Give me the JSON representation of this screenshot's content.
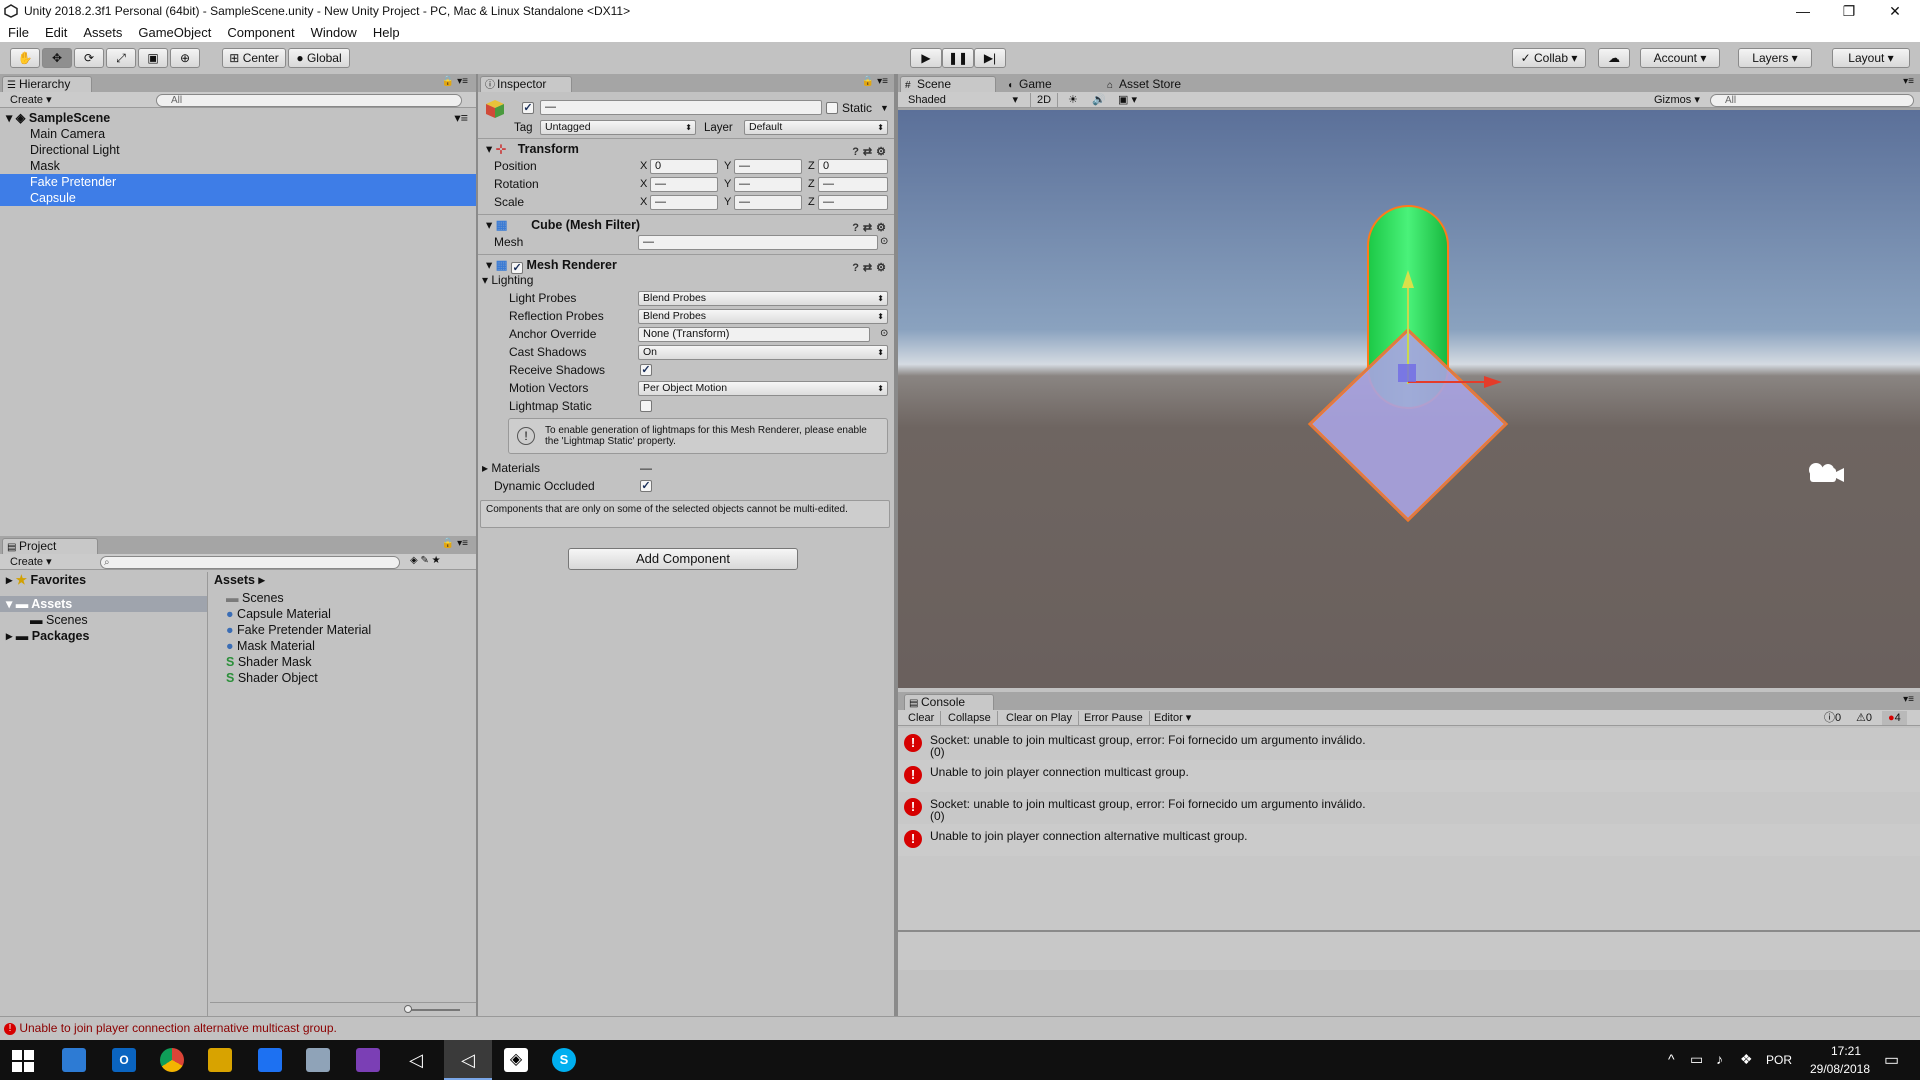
{
  "window": {
    "title": "Unity 2018.2.3f1 Personal (64bit) - SampleScene.unity - New Unity Project - PC, Mac & Linux Standalone <DX11>"
  },
  "menu": [
    "File",
    "Edit",
    "Assets",
    "GameObject",
    "Component",
    "Window",
    "Help"
  ],
  "toolbar": {
    "pivot": "Center",
    "space": "Global",
    "collab": "Collab",
    "account": "Account",
    "layers": "Layers",
    "layout": "Layout"
  },
  "hierarchy": {
    "tab": "Hierarchy",
    "create": "Create",
    "search_placeholder": "All",
    "scene": "SampleScene",
    "items": [
      {
        "label": "Main Camera",
        "selected": false
      },
      {
        "label": "Directional Light",
        "selected": false
      },
      {
        "label": "Mask",
        "selected": false
      },
      {
        "label": "Fake Pretender",
        "selected": true
      },
      {
        "label": "Capsule",
        "selected": true
      }
    ]
  },
  "project": {
    "tab": "Project",
    "create": "Create",
    "tree": {
      "favorites": "Favorites",
      "assets": "Assets",
      "scenes": "Scenes",
      "packages": "Packages"
    },
    "breadcrumb": "Assets",
    "files": [
      {
        "label": "Scenes",
        "icon": "folder-icon"
      },
      {
        "label": "Capsule Material",
        "icon": "material-icon"
      },
      {
        "label": "Fake Pretender Material",
        "icon": "material-icon"
      },
      {
        "label": "Mask Material",
        "icon": "material-icon"
      },
      {
        "label": "Shader Mask",
        "icon": "shader-icon"
      },
      {
        "label": "Shader Object",
        "icon": "shader-icon"
      }
    ]
  },
  "inspector": {
    "tab": "Inspector",
    "name_value": "—",
    "static_label": "Static",
    "tag_label": "Tag",
    "tag_value": "Untagged",
    "layer_label": "Layer",
    "layer_value": "Default",
    "transform": {
      "title": "Transform",
      "position": "Position",
      "rotation": "Rotation",
      "scale": "Scale",
      "axis_x": "X",
      "axis_y": "Y",
      "axis_z": "Z",
      "pos_x": "0",
      "pos_y": "—",
      "pos_z": "0",
      "mixed": "—"
    },
    "mesh_filter": {
      "title": "Cube (Mesh Filter)",
      "mesh_label": "Mesh",
      "mesh_value": "—"
    },
    "mesh_renderer": {
      "title": "Mesh Renderer",
      "lighting": "Lighting",
      "light_probes_label": "Light Probes",
      "light_probes_value": "Blend Probes",
      "reflection_probes_label": "Reflection Probes",
      "reflection_probes_value": "Blend Probes",
      "anchor_override_label": "Anchor Override",
      "anchor_override_value": "None (Transform)",
      "cast_shadows_label": "Cast Shadows",
      "cast_shadows_value": "On",
      "receive_shadows_label": "Receive Shadows",
      "motion_vectors_label": "Motion Vectors",
      "motion_vectors_value": "Per Object Motion",
      "lightmap_static_label": "Lightmap Static",
      "info": "To enable generation of lightmaps for this Mesh Renderer, please enable the 'Lightmap Static' property.",
      "materials_label": "Materials",
      "materials_value": "—",
      "dynamic_occluded_label": "Dynamic Occluded"
    },
    "multi_edit_note": "Components that are only on some of the selected objects cannot be multi-edited.",
    "add_component": "Add Component"
  },
  "scene": {
    "tabs": [
      "Scene",
      "Game",
      "Asset Store"
    ],
    "shading": "Shaded",
    "mode_2d": "2D",
    "gizmos": "Gizmos",
    "search_placeholder": "All"
  },
  "console": {
    "tab": "Console",
    "buttons": [
      "Clear",
      "Collapse",
      "Clear on Play",
      "Error Pause",
      "Editor"
    ],
    "counts": {
      "info": "0",
      "warn": "0",
      "error": "4"
    },
    "messages": [
      {
        "line1": "Socket: unable to join multicast group, error: Foi fornecido um argumento inválido.",
        "line2": "(0)"
      },
      {
        "line1": "Unable to join player connection multicast group.",
        "line2": ""
      },
      {
        "line1": "Socket: unable to join multicast group, error: Foi fornecido um argumento inválido.",
        "line2": "(0)"
      },
      {
        "line1": "Unable to join player connection alternative multicast group.",
        "line2": ""
      }
    ]
  },
  "statusbar": {
    "message": "Unable to join player connection alternative multicast group."
  },
  "taskbar": {
    "language": "POR",
    "time": "17:21",
    "date": "29/08/2018"
  },
  "colors": {
    "selection": "#3e7de7",
    "error": "#d60000",
    "capsule_green": "#2ee05a",
    "selection_outline": "#ff7a1a"
  }
}
